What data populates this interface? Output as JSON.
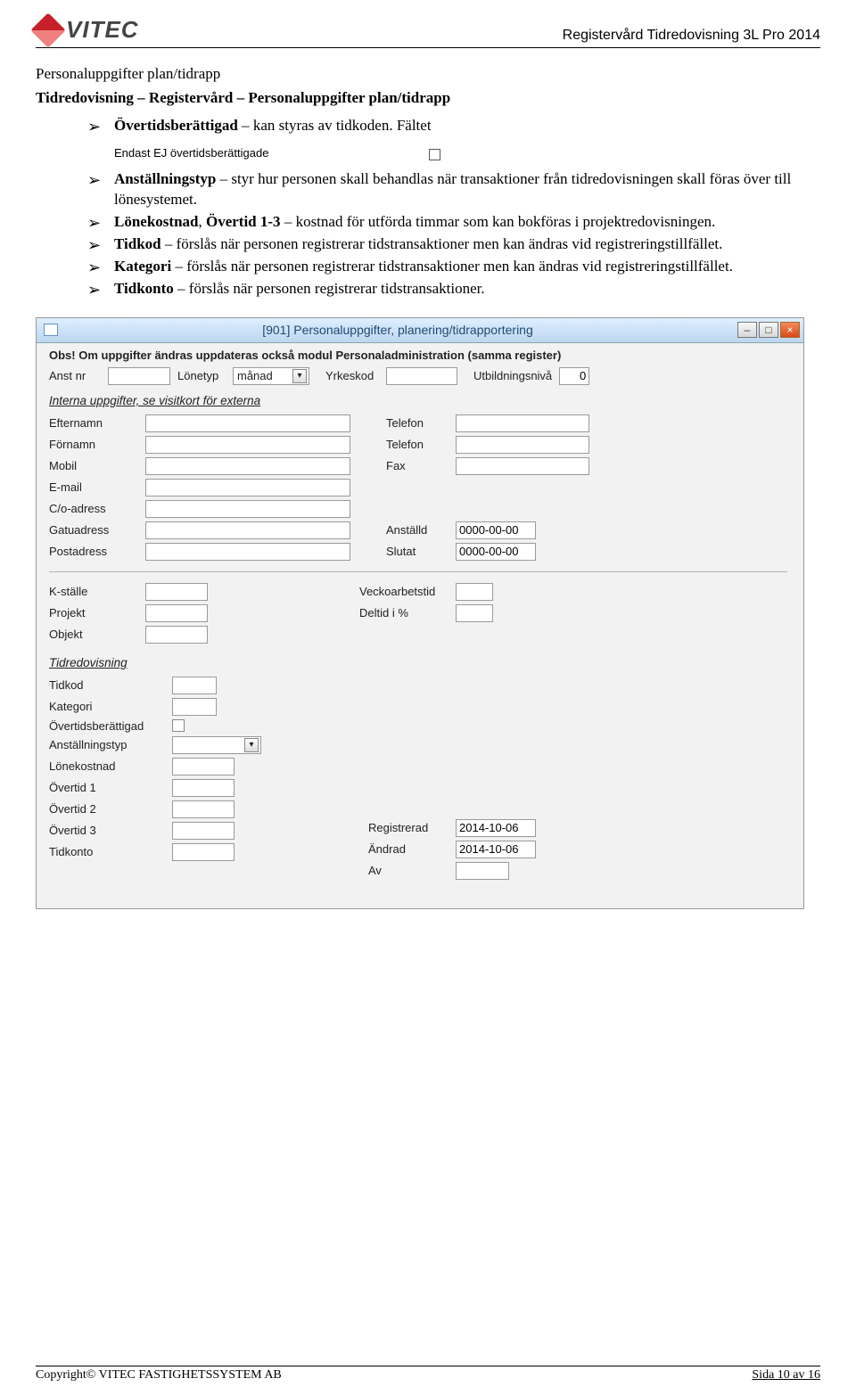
{
  "header": {
    "logo_text": "VITEC",
    "doc_title": "Registervård Tidredovisning 3L Pro 2014"
  },
  "section": {
    "h1": "Personaluppgifter plan/tidrapp",
    "h2": "Tidredovisning – Registervård – Personaluppgifter plan/tidrapp"
  },
  "bullets_top": {
    "b1_strong": "Övertidsberättigad",
    "b1_rest": " – kan styras av tidkoden. Fältet"
  },
  "inline_checkbox_label": "Endast EJ övertidsberättigade",
  "bullets": {
    "b2_strong": "Anställningstyp",
    "b2_rest": " – styr hur personen skall behandlas när transaktioner från tidredovisningen skall föras över till lönesystemet.",
    "b3_strong": "Lönekostnad",
    "b3_mid": ", ",
    "b3_strong2": "Övertid 1-3",
    "b3_rest": " – kostnad för utförda timmar som kan bokföras i projektredovisningen.",
    "b4_strong": "Tidkod",
    "b4_rest": " – förslås när personen registrerar tidstransaktioner men kan ändras vid registreringstillfället.",
    "b5_strong": "Kategori",
    "b5_rest": " – förslås när personen registrerar tidstransaktioner men kan ändras vid registreringstillfället.",
    "b6_strong": "Tidkonto",
    "b6_rest": " – förslås när personen registrerar tidstransaktioner."
  },
  "window": {
    "title": "[901]  Personaluppgifter, planering/tidrapportering",
    "notice": "Obs! Om uppgifter ändras uppdateras också modul Personaladministration (samma register)",
    "row1": {
      "anstnr_label": "Anst nr",
      "lonetype_label": "Lönetyp",
      "lonetype_value": "månad",
      "yrkeskod_label": "Yrkeskod",
      "utbild_label": "Utbildningsnivå",
      "utbild_value": "0"
    },
    "section1_title": "Interna uppgifter, se visitkort för externa",
    "labels": {
      "efternamn": "Efternamn",
      "fornamn": "Förnamn",
      "mobil": "Mobil",
      "email": "E-mail",
      "co": "C/o-adress",
      "gatu": "Gatuadress",
      "post": "Postadress",
      "telefon": "Telefon",
      "fax": "Fax",
      "anstalld": "Anställd",
      "slutat": "Slutat"
    },
    "dates": {
      "anstalld": "0000-00-00",
      "slutat": "0000-00-00"
    },
    "section2": {
      "kstalle": "K-ställe",
      "projekt": "Projekt",
      "objekt": "Objekt",
      "veckoarb": "Veckoarbetstid",
      "deltid": "Deltid i %"
    },
    "section3_title": "Tidredovisning",
    "tid": {
      "tidkod": "Tidkod",
      "kategori": "Kategori",
      "overtidsb": "Övertidsberättigad",
      "anstallningstyp": "Anställningstyp",
      "lonekostnad": "Lönekostnad",
      "overtid1": "Övertid 1",
      "overtid2": "Övertid 2",
      "overtid3": "Övertid 3",
      "tidkonto": "Tidkonto",
      "reg_label": "Registrerad",
      "reg_value": "2014-10-06",
      "andrad_label": "Ändrad",
      "andrad_value": "2014-10-06",
      "av_label": "Av"
    }
  },
  "footer": {
    "copyright_prefix": "Copyright© V",
    "copyright_rest": "ITEC FASTIGHETSSYSTEM AB",
    "page": "Sida 10 av 16"
  }
}
